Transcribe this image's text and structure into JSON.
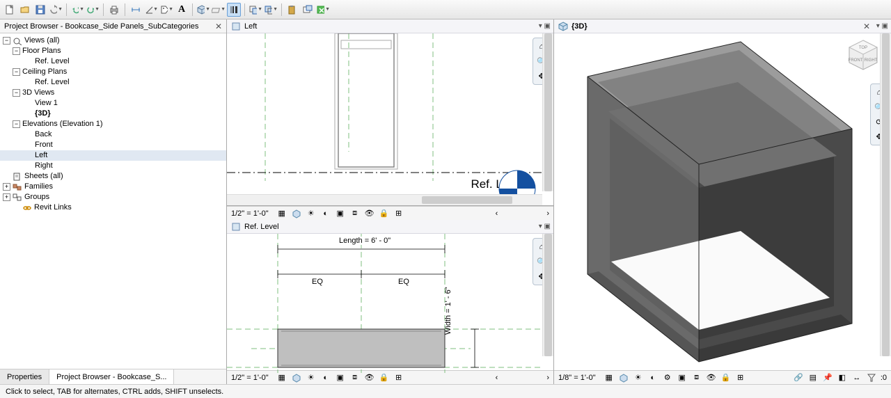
{
  "toolbar": {
    "icons": [
      "new",
      "open",
      "save",
      "sync",
      "undo",
      "redo",
      "print",
      "measure-align",
      "measure-angle",
      "tag",
      "text",
      "model-insert",
      "set-plane",
      "thin-lines",
      "cut",
      "join",
      "paste",
      "switch-window",
      "close-view"
    ]
  },
  "project_browser": {
    "title": "Project Browser - Bookcase_Side Panels_SubCategories",
    "tabs": {
      "properties": "Properties",
      "browser": "Project Browser - Bookcase_S..."
    },
    "tree": [
      {
        "lvl": 0,
        "toggle": "−",
        "icon": "views",
        "label": "Views (all)"
      },
      {
        "lvl": 1,
        "toggle": "−",
        "label": "Floor Plans"
      },
      {
        "lvl": 3,
        "label": "Ref. Level"
      },
      {
        "lvl": 1,
        "toggle": "−",
        "label": "Ceiling Plans"
      },
      {
        "lvl": 3,
        "label": "Ref. Level"
      },
      {
        "lvl": 1,
        "toggle": "−",
        "label": "3D Views"
      },
      {
        "lvl": 3,
        "label": "View 1"
      },
      {
        "lvl": 3,
        "label": "{3D}",
        "bold": true
      },
      {
        "lvl": 1,
        "toggle": "−",
        "label": "Elevations (Elevation 1)"
      },
      {
        "lvl": 3,
        "label": "Back"
      },
      {
        "lvl": 3,
        "label": "Front"
      },
      {
        "lvl": 3,
        "label": "Left",
        "selected": true
      },
      {
        "lvl": 3,
        "label": "Right"
      },
      {
        "lvl": 0,
        "toggle": "",
        "icon": "sheets",
        "label": "Sheets (all)"
      },
      {
        "lvl": 0,
        "toggle": "+",
        "icon": "families",
        "label": "Families"
      },
      {
        "lvl": 0,
        "toggle": "+",
        "icon": "groups",
        "label": "Groups"
      },
      {
        "lvl": 0,
        "toggle": "",
        "icon": "links",
        "label": "Revit Links",
        "indent_extra": true
      }
    ]
  },
  "views": {
    "left_top": {
      "title": "Left",
      "scale": "1/2\" = 1'-0\"",
      "ref_label": "Ref. Level"
    },
    "left_bottom": {
      "title": "Ref. Level",
      "scale": "1/2\" = 1'-0\"",
      "dim_length": "Length = 6' - 0\"",
      "eq1": "EQ",
      "eq2": "EQ",
      "dim_width": "Width = 1' - 6\""
    },
    "right_3d": {
      "title": "{3D}",
      "scale": "1/8\" = 1'-0\"",
      "cube": {
        "top": "TOP",
        "front": "FRONT",
        "right": "RIGHT"
      }
    }
  },
  "view_controls": [
    "detail",
    "model",
    "shadows",
    "sun",
    "crop",
    "crop-region",
    "annot-crop",
    "temp-hide",
    "reveal",
    "constraints"
  ],
  "right_status_icons": [
    "sel-link",
    "sel-underlay",
    "sel-pinned",
    "sel-face",
    "drag",
    "filter-count"
  ],
  "filter_count": ":0",
  "statusbar": {
    "hint": "Click to select, TAB for alternates, CTRL adds, SHIFT unselects."
  }
}
